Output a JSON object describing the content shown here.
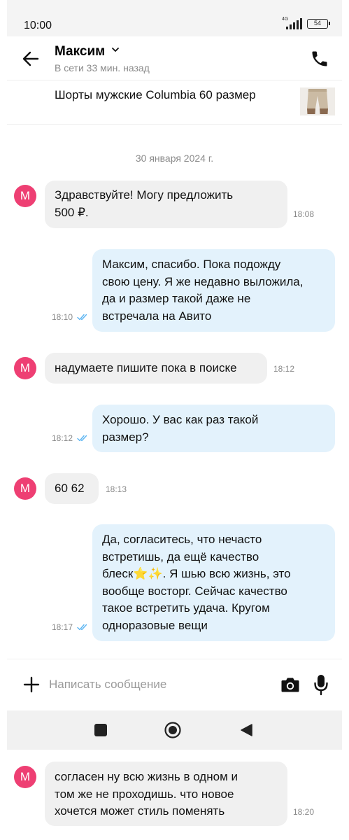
{
  "status_bar": {
    "time": "10:00",
    "network": "4G",
    "battery": "54"
  },
  "header": {
    "contact_name": "Максим",
    "contact_status": "В сети 33 мин. назад"
  },
  "listing": {
    "title": "Шорты мужские Columbia 60 размер"
  },
  "date_separator": "30 января 2024 г.",
  "avatar_letter": "М",
  "messages": [
    {
      "direction": "incoming",
      "lines": [
        "Здравствуйте! Могу предложить",
        "500 ₽."
      ],
      "time": "18:08"
    },
    {
      "direction": "outgoing",
      "lines": [
        "Максим, спасибо. Пока подожду",
        "свою цену. Я же недавно выложила,",
        "да и размер такой даже не",
        "встречала на Авито"
      ],
      "time": "18:10",
      "read": true
    },
    {
      "direction": "incoming",
      "lines": [
        "надумаете пишите пока в поиске"
      ],
      "time": "18:12"
    },
    {
      "direction": "outgoing",
      "lines": [
        "Хорошо. У вас как раз такой",
        "размер?"
      ],
      "time": "18:12",
      "read": true
    },
    {
      "direction": "incoming",
      "lines": [
        "60 62"
      ],
      "time": "18:13"
    },
    {
      "direction": "outgoing",
      "lines": [
        "Да, согласитесь, что нечасто",
        "встретишь, да ещё качество",
        "блеск⭐✨. Я шью всю жизнь, это",
        "вообще восторг. Сейчас качество",
        "такое встретить удача. Кругом",
        "одноразовые вещи"
      ],
      "time": "18:17",
      "read": true
    },
    {
      "direction": "incoming",
      "lines": [
        "согласен ну всю жизнь в одном и",
        "том же не проходишь. что новое",
        "хочется может стиль поменять"
      ],
      "time": "18:20"
    }
  ],
  "composer": {
    "placeholder": "Написать сообщение"
  },
  "colors": {
    "avatar": "#ee3f73",
    "incoming_bubble": "#f0f0f0",
    "outgoing_bubble": "#e3f2fc",
    "read_ticks": "#5cb5f2"
  },
  "icons": [
    "back-arrow-icon",
    "chevron-down-icon",
    "phone-icon",
    "plus-icon",
    "camera-icon",
    "microphone-icon",
    "double-check-icon",
    "nav-recents-icon",
    "nav-home-icon",
    "nav-back-icon"
  ]
}
